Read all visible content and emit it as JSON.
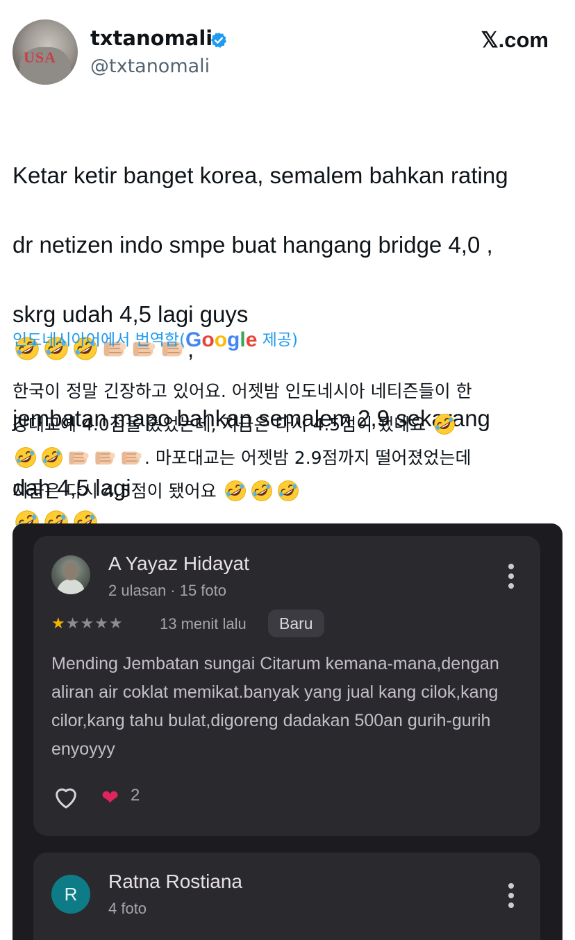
{
  "header": {
    "display_name": "txtanomali",
    "handle": "@txtanomali",
    "site": "𝕏.com"
  },
  "tweet": {
    "line1": "Ketar ketir banget korea, semalem bahkan rating",
    "line2": "dr netizen indo smpe buat hangang bridge 4,0 ,",
    "line3_a": "skrg udah 4,5 lagi guys",
    "line3_b": ",",
    "line4": "jembatan mapo bahkan semalem 2,9 sekarang",
    "line5": "dah 4,5 lagi"
  },
  "translation": {
    "label_prefix": "인도네시아어에서 번역함(",
    "label_suffix": " 제공)",
    "google_letters": [
      "G",
      "o",
      "o",
      "g",
      "l",
      "e"
    ],
    "google_colors": [
      "#4285f4",
      "#ea4335",
      "#fbbc05",
      "#4285f4",
      "#34a853",
      "#ea4335"
    ],
    "line1": "한국이 정말 긴장하고 있어요. 어젯밤 인도네시아 네티즌들이 한",
    "line2": "강대교에 4.0점을 줬었는데, 지금은 다시 4.5점이 됐네요",
    "line3_b": ". 마포대교는 어젯밤 2.9점까지 떨어졌었는데",
    "line4": "지금은 다시 4.5점이 됐어요"
  },
  "reviews": [
    {
      "name": "A Yayaz Hidayat",
      "meta": "2 ulasan · 15 foto",
      "rating": 1,
      "rating_max": 5,
      "time": "13 menit lalu",
      "badge": "Baru",
      "body": "Mending Jembatan sungai Citarum kemana-mana,dengan aliran air coklat memikat.banyak yang jual kang cilok,kang cilor,kang tahu bulat,digoreng dadakan 500an gurih-gurih enyoyyy",
      "reaction_count": "2"
    },
    {
      "name": "Ratna Rostiana",
      "meta": "4 foto",
      "avatar_letter": "R"
    }
  ],
  "colors": {
    "link_blue": "#1d9bf0",
    "verified_blue": "#1d9bf0",
    "embed_bg": "#1c1b1f",
    "card_bg": "#2a292e",
    "star_yellow": "#f4b400",
    "avatar_teal": "#0e7c86"
  },
  "icons": {
    "verified": "verified-badge-icon",
    "rofl": "rolling-on-floor-laughing-emoji",
    "fist": "oncoming-fist-emoji",
    "more": "more-vertical-icon",
    "like": "heart-outline-icon",
    "love": "red-heart-icon"
  }
}
